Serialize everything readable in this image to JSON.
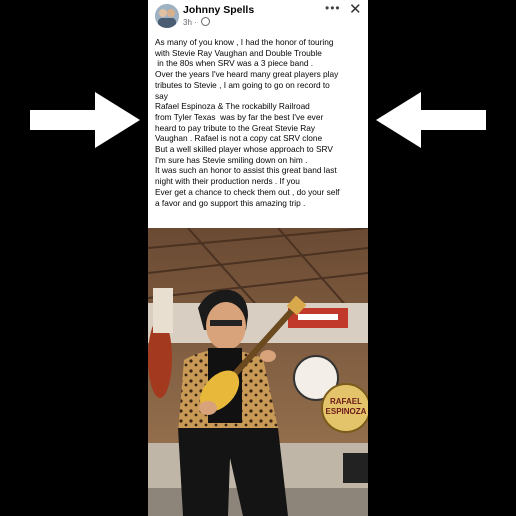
{
  "post": {
    "author": "Johnny Spells",
    "time": "3h",
    "menu_icon": "more-icon",
    "close_icon": "close-icon",
    "lines": [
      "As many of you know , I had the honor of touring",
      "with Stevie Ray Vaughan and Double Trouble",
      " in the 80s when SRV was a 3 piece band .",
      "Over the years I've heard many great players play",
      "tributes to Stevie , I am going to go on record to",
      "say",
      "Rafael Espinoza & The rockabilly Railroad",
      "from Tyler Texas  was by far the best I've ever",
      "heard to pay tribute to the Great Stevie Ray",
      "Vaughan . Rafael is not a copy cat SRV clone",
      "But a well skilled player whose approach to SRV",
      "I'm sure has Stevie smiling down on him .",
      "It was such an honor to assist this great band last",
      "night with their production nerds . If you",
      "Ever get a chance to check them out , do your self",
      "a favor and go support this amazing trip ."
    ]
  },
  "photo": {
    "drum_text": "RAFAEL ESPINOZA"
  },
  "overlay": {
    "arrow_color": "#ffffff"
  }
}
